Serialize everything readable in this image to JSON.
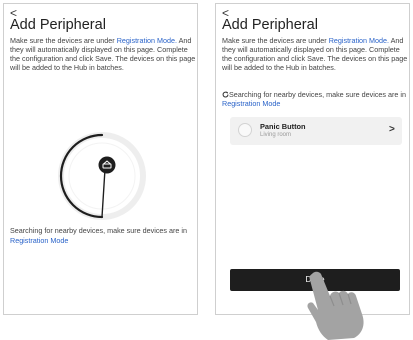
{
  "screen1": {
    "back": "<",
    "title": "Add Peripheral",
    "desc_pre": "Make sure the devices are under ",
    "desc_link": "Registration Mode.",
    "desc_post": " And they will automatically displayed on this page. Complete the configuration and click Save. The devices on this page will be added to the Hub in batches.",
    "search_pre": "Searching for nearby devices, make sure devices are in ",
    "search_link": "Registration Mode",
    "icon": "hub-icon"
  },
  "screen2": {
    "back": "<",
    "title": "Add Peripheral",
    "desc_pre": "Make sure the devices are under ",
    "desc_link": "Registration Mode.",
    "desc_post": " And they will automatically displayed on this page. Complete the configuration and click Save. The devices on this page will be added to the Hub in batches.",
    "search_pre": "Searching for nearby devices, make sure devices are in ",
    "search_link": "Registration Mode",
    "device": {
      "name": "Panic Button",
      "room": "Living room",
      "chevron": ">"
    },
    "done": "Done"
  },
  "colors": {
    "link": "#2a63c9",
    "button": "#1e1e1e",
    "device_bg": "#f1f1f1"
  }
}
